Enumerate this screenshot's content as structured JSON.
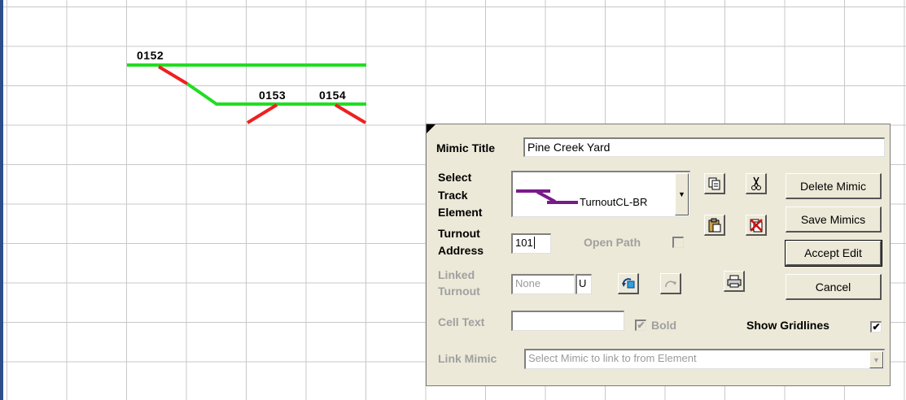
{
  "grid_labels": {
    "cell_0152": "0152",
    "cell_0153": "0153",
    "cell_0154": "0154"
  },
  "colors": {
    "track_main": "#22dd22",
    "track_diverge": "#ee2020",
    "element_preview": "#7a1a8a"
  },
  "panel": {
    "mimic_title_label": "Mimic Title",
    "mimic_title_value": "Pine Creek Yard",
    "select_track_label_1": "Select",
    "select_track_label_2": "Track",
    "select_track_label_3": "Element",
    "track_element_value": "TurnoutCL-BR",
    "turnout_address_label_1": "Turnout",
    "turnout_address_label_2": "Address",
    "turnout_address_value": "101",
    "open_path_label": "Open Path",
    "linked_turnout_label_1": "Linked",
    "linked_turnout_label_2": "Turnout",
    "linked_turnout_value": "None",
    "linked_turnout_flag": "U",
    "cell_text_label": "Cell Text",
    "cell_text_value": "",
    "bold_label": "Bold",
    "show_gridlines_label": "Show Gridlines",
    "show_gridlines_check": "✔",
    "bold_check": "✔",
    "link_mimic_label": "Link Mimic",
    "link_mimic_placeholder": "Select Mimic to link to from Element",
    "buttons": {
      "delete": "Delete Mimic",
      "save": "Save Mimics",
      "accept": "Accept Edit",
      "cancel": "Cancel"
    },
    "icons": {
      "copy": "copy-icon",
      "cut": "cut-icon",
      "paste": "paste-icon",
      "delete_element": "delete-element-icon",
      "rotate": "rotate-icon",
      "redo": "redo-icon",
      "print": "print-icon"
    }
  }
}
